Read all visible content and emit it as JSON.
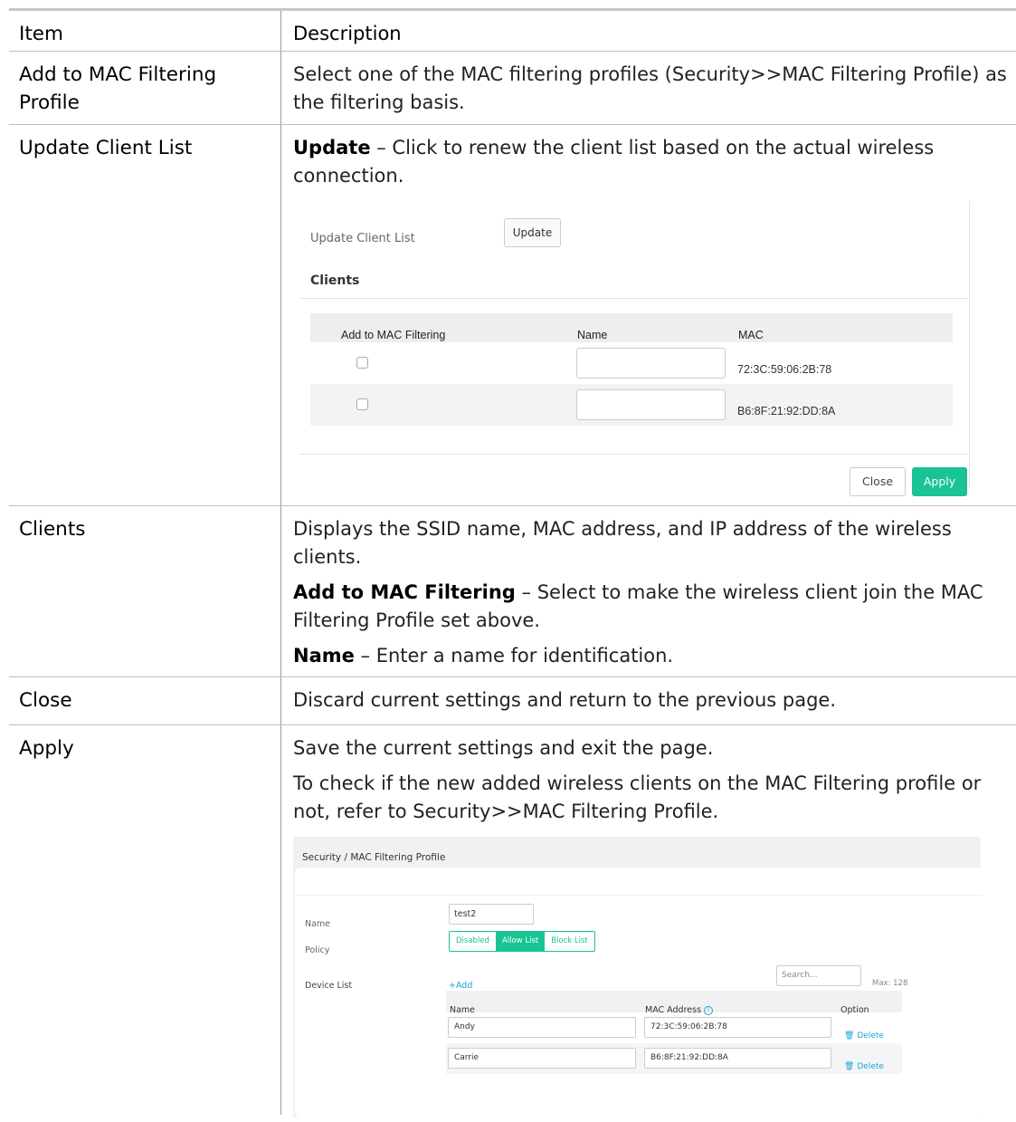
{
  "table": {
    "header": {
      "item": "Item",
      "description": "Description"
    },
    "rows": [
      {
        "item": "Add to MAC Filtering Profile",
        "desc": "Select one of the MAC filtering profiles (Security>>MAC Filtering Profile) as the filtering basis."
      },
      {
        "item": "Update Client List",
        "desc_bold": "Update",
        "desc": " – Click to renew the client list based on the actual wireless connection."
      },
      {
        "item": "Clients",
        "desc": "Displays the SSID name, MAC address, and IP address of the wireless clients.",
        "p2_bold": "Add to MAC Filtering",
        "p2": " – Select to make the wireless client join the MAC Filtering Profile set above.",
        "p3_bold": "Name",
        "p3": " – Enter a name for identification."
      },
      {
        "item": "Close",
        "desc": "Discard current settings and return to the previous page."
      },
      {
        "item": "Apply",
        "desc": "Save the current settings and exit the page.",
        "p2": "To check if the new added wireless clients on the MAC Filtering profile or not, refer to Security>>MAC Filtering Profile."
      }
    ]
  },
  "shot1": {
    "update_label": "Update Client List",
    "update_button": "Update",
    "clients_title": "Clients",
    "columns": [
      "Add to MAC Filtering",
      "Name",
      "MAC"
    ],
    "rows": [
      {
        "mac": "72:3C:59:06:2B:78"
      },
      {
        "mac": "B6:8F:21:92:DD:8A"
      }
    ],
    "close": "Close",
    "apply": "Apply",
    "accent": "#19c393"
  },
  "shot2": {
    "breadcrumb": "Security / MAC Filtering Profile",
    "name_label": "Name",
    "name_value": "test2",
    "policy_label": "Policy",
    "policy_options": [
      "Disabled",
      "Allow List",
      "Block List"
    ],
    "policy_selected": "Allow List",
    "device_list_label": "Device List",
    "add": "+Add",
    "search_placeholder": "Search...",
    "max": "Max: 128",
    "columns": [
      "Name",
      "MAC Address",
      "Option"
    ],
    "devices": [
      {
        "name": "Andy",
        "mac": "72:3C:59:06:2B:78",
        "option": "Delete"
      },
      {
        "name": "Carrie",
        "mac": "B6:8F:21:92:DD:8A",
        "option": "Delete"
      }
    ],
    "link_color": "#19a4d6"
  }
}
